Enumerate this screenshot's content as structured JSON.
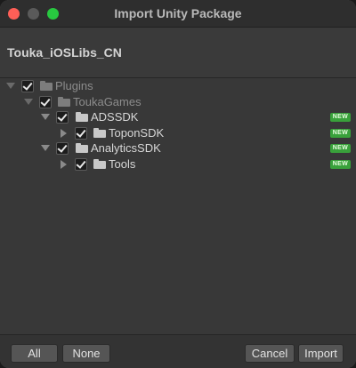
{
  "window": {
    "title": "Import Unity Package"
  },
  "header": {
    "package_name": "Touka_iOSLibs_CN"
  },
  "tree": {
    "items": [
      {
        "label": "Plugins",
        "checked": true,
        "expanded": true,
        "dim": true,
        "badge": ""
      },
      {
        "label": "ToukaGames",
        "checked": true,
        "expanded": true,
        "dim": true,
        "badge": ""
      },
      {
        "label": "ADSSDK",
        "checked": true,
        "expanded": true,
        "dim": false,
        "badge": "NEW"
      },
      {
        "label": "ToponSDK",
        "checked": true,
        "expanded": false,
        "dim": false,
        "badge": "NEW"
      },
      {
        "label": "AnalyticsSDK",
        "checked": true,
        "expanded": true,
        "dim": false,
        "badge": "NEW"
      },
      {
        "label": "Tools",
        "checked": true,
        "expanded": false,
        "dim": false,
        "badge": "NEW"
      }
    ]
  },
  "footer": {
    "all_label": "All",
    "none_label": "None",
    "cancel_label": "Cancel",
    "import_label": "Import"
  },
  "colors": {
    "badge_green": "#39a13b",
    "close": "#ff5f57",
    "maximize": "#28c840"
  }
}
